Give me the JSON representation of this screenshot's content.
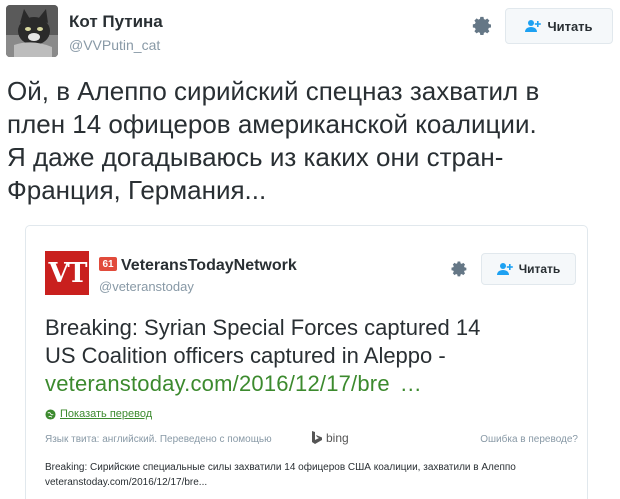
{
  "tweet": {
    "author_name": "Кот Путина",
    "author_handle": "@VVPutin_cat",
    "follow_label": "Читать",
    "text": "Ой, в Алеппо сирийский спецназ захватил в\nплен 14 офицеров американской коалиции.\nЯ даже догадываюсь из каких они стран-\nФранция, Германия..."
  },
  "quoted": {
    "logo_text": "VT",
    "badge": "61",
    "author_name": "VeteransTodayNetwork",
    "author_handle": "@veteranstoday",
    "follow_label": "Читать",
    "text_line1": "Breaking: Syrian Special Forces captured 14",
    "text_line2": "US Coalition officers captured in Aleppo -",
    "link": "veteranstoday.com/2016/12/17/bre",
    "link_ellipsis": "…",
    "translate_label": "Показать перевод",
    "translation_meta": "Язык твита: английский. Переведено с помощью",
    "bing_label": "bing",
    "translation_error": "Ошибка в переводе?",
    "translation_text": "Breaking: Сирийские специальные силы захватили 14 офицеров США коалиции, захватили в Алеппо veteranstoday.com/2016/12/17/bre..."
  },
  "icons": {
    "gear": "gear-icon",
    "follow": "add-user-icon",
    "globe": "globe-icon",
    "bing": "bing-logo"
  },
  "colors": {
    "link_green": "#3c8a2e",
    "vt_red": "#c9201e",
    "muted": "#8899a6",
    "text": "#292f33",
    "button_border": "#e1e8ed"
  }
}
